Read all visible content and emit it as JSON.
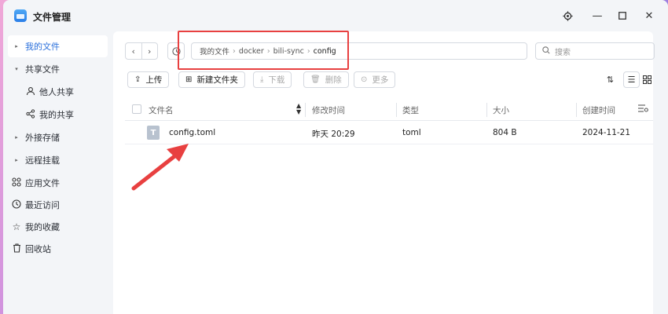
{
  "window": {
    "title": "文件管理"
  },
  "sidebar": {
    "items": [
      {
        "label": "我的文件",
        "icon": "caret-right-icon",
        "active": true
      },
      {
        "label": "共享文件",
        "icon": "caret-down-icon"
      },
      {
        "label": "他人共享",
        "icon": "person-icon"
      },
      {
        "label": "我的共享",
        "icon": "share-icon"
      },
      {
        "label": "外接存储",
        "icon": "caret-right-icon"
      },
      {
        "label": "远程挂载",
        "icon": "caret-right-icon"
      },
      {
        "label": "应用文件",
        "icon": "apps-icon"
      },
      {
        "label": "最近访问",
        "icon": "clock-icon"
      },
      {
        "label": "我的收藏",
        "icon": "star-icon"
      },
      {
        "label": "回收站",
        "icon": "trash-icon"
      }
    ]
  },
  "path": {
    "segments": [
      "我的文件",
      "docker",
      "bili-sync",
      "config"
    ]
  },
  "search": {
    "placeholder": "搜索"
  },
  "toolbar": {
    "upload": "上传",
    "new_folder": "新建文件夹",
    "download": "下载",
    "delete": "删除",
    "more": "更多"
  },
  "table": {
    "headers": {
      "name": "文件名",
      "modified": "修改时间",
      "type": "类型",
      "size": "大小",
      "created": "创建时间"
    },
    "rows": [
      {
        "icon_letter": "T",
        "name": "config.toml",
        "modified": "昨天 20:29",
        "type": "toml",
        "size": "804 B",
        "created": "2024-11-21"
      }
    ]
  },
  "colors": {
    "accent": "#2a6fdb",
    "annotation": "#e84040"
  }
}
